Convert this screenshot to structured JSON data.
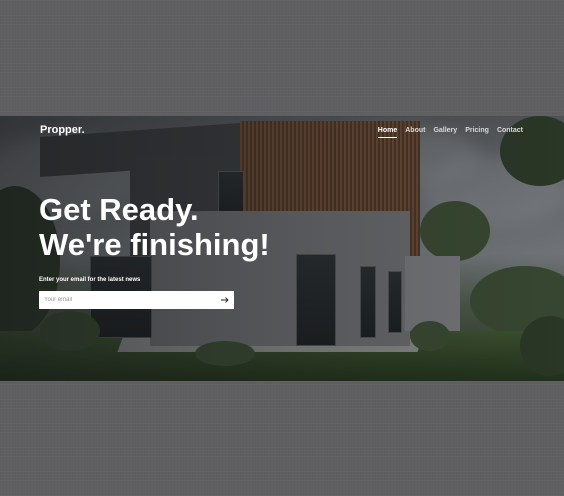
{
  "brand": {
    "logo_text": "Propper."
  },
  "nav": {
    "items": [
      {
        "label": "Home",
        "active": true
      },
      {
        "label": "About",
        "active": false
      },
      {
        "label": "Gallery",
        "active": false
      },
      {
        "label": "Pricing",
        "active": false
      },
      {
        "label": "Contact",
        "active": false
      }
    ]
  },
  "hero": {
    "headline_line1": "Get Ready.",
    "headline_line2": "We're finishing!",
    "subscribe_label": "Enter your email for the latest news",
    "email_placeholder": "Your email",
    "submit_icon": "arrow-right-icon"
  }
}
